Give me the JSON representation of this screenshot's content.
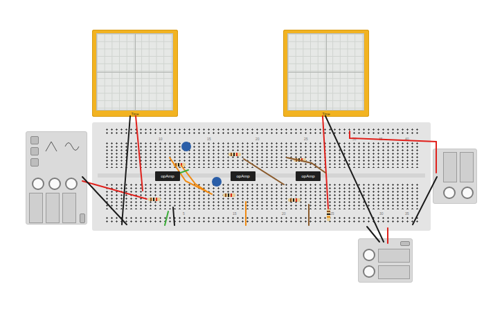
{
  "oscilloscopes": [
    {
      "time_label": "Time"
    },
    {
      "time_label": "Time"
    }
  ],
  "opamps": [
    {
      "label": "opAmp"
    },
    {
      "label": "opAmp"
    },
    {
      "label": "opAmp"
    }
  ],
  "breadboard": {
    "top_numbers": [
      "10",
      "15",
      "20",
      "25",
      "30",
      "35",
      "40"
    ],
    "bottom_numbers": [
      "5",
      "15",
      "20",
      "25",
      "30",
      "35"
    ]
  },
  "wires": [
    {
      "color": "#e0201b"
    },
    {
      "color": "#1b1b1b"
    },
    {
      "color": "#e0201b"
    },
    {
      "color": "#1b1b1b"
    },
    {
      "color": "#e0201b"
    },
    {
      "color": "#1b1b1b"
    },
    {
      "color": "#e0201b"
    },
    {
      "color": "#1b1b1b"
    },
    {
      "color": "#1b1b1b"
    },
    {
      "color": "#e0201b"
    },
    {
      "color": "#f08a12"
    },
    {
      "color": "#f08a12"
    },
    {
      "color": "#f08a12"
    },
    {
      "color": "#3cad3a"
    },
    {
      "color": "#3cad3a"
    },
    {
      "color": "#8a5a2b"
    },
    {
      "color": "#8a5a2b"
    },
    {
      "color": "#8a5a2b"
    },
    {
      "color": "#1b1b1b"
    }
  ]
}
